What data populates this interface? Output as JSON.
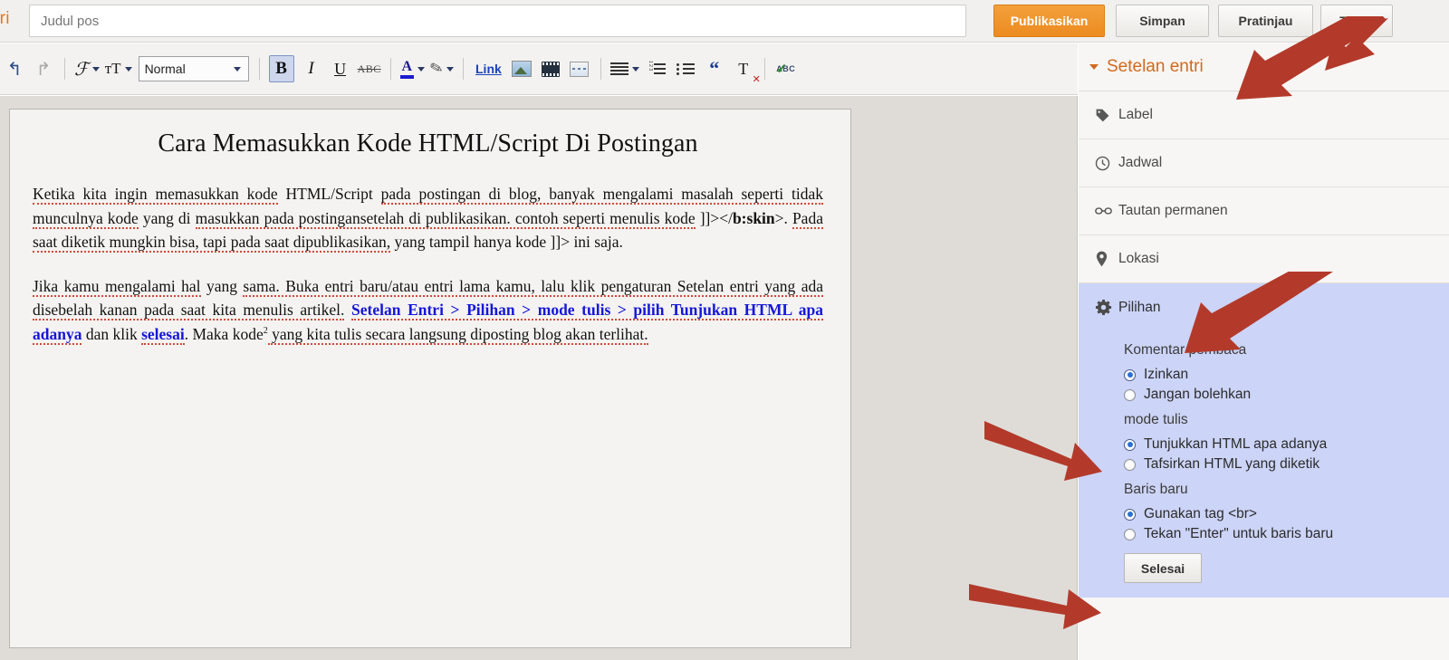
{
  "topbar": {
    "brand_cut": "tri",
    "title_placeholder": "Judul pos",
    "title_value": "",
    "publish_label": "Publikasikan",
    "save_label": "Simpan",
    "preview_label": "Pratinjau",
    "close_label": "Tutup",
    "publish_color": "#ec8b20"
  },
  "toolbar": {
    "undo": "↰",
    "redo": "↱",
    "font": "ℱ",
    "font_size": "тT",
    "format_select": "Normal",
    "bold": "B",
    "italic": "I",
    "underline": "U",
    "strikethrough": "ABC",
    "text_color": "A",
    "highlight": "✎",
    "link": "Link",
    "quote": "“",
    "remove_format": "T",
    "spellcheck": "ABC"
  },
  "document": {
    "title": "Cara Memasukkan Kode HTML/Script Di Postingan",
    "paragraph1": [
      {
        "t": "Ketika kita ingin memasukkan kode",
        "s": "spell"
      },
      {
        "t": " HTML/Script ",
        "s": "plain"
      },
      {
        "t": "pada postingan di blog,  banyak mengalami masalah seperti tidak munculnya kode",
        "s": "spell"
      },
      {
        "t": " yang di ",
        "s": "plain"
      },
      {
        "t": "masukkan pada postingansetelah di publikasikan. contoh seperti menulis kode",
        "s": "spell"
      },
      {
        "t": " ]]></",
        "s": "plain"
      },
      {
        "t": "b:skin",
        "s": "bold"
      },
      {
        "t": ">. ",
        "s": "plain"
      },
      {
        "t": "Pada saat diketik mungkin bisa, tapi pada saat dipublikasikan,",
        "s": "spell"
      },
      {
        "t": " yang tampil hanya kode ]]> ini saja.",
        "s": "plain"
      }
    ],
    "paragraph2": [
      {
        "t": "Jika kamu mengalami hal",
        "s": "spell"
      },
      {
        "t": " yang ",
        "s": "plain"
      },
      {
        "t": "sama. Buka entri baru/atau entri lama kamu, lalu klik pengaturan Setelan entri yang ada disebelah kanan pada saat kita menulis artikel.",
        "s": "spell"
      },
      {
        "t": " ",
        "s": "plain"
      },
      {
        "t": "Setelan Entri > Pilihan > mode tulis > pilih Tunjukan HTML apa adanya",
        "s": "blue"
      },
      {
        "t": " dan klik ",
        "s": "plain"
      },
      {
        "t": "selesai",
        "s": "blue"
      },
      {
        "t": ". Maka kode",
        "s": "plain"
      },
      {
        "t": "2",
        "s": "sup"
      },
      {
        "t": " yang kita tulis secara langsung diposting blog akan terlihat.",
        "s": "spell"
      }
    ]
  },
  "sidebar": {
    "header": "Setelan entri",
    "header_color": "#d2691e",
    "rows": [
      {
        "label": "Label",
        "icon": "tag-icon",
        "glyph": "🏷"
      },
      {
        "label": "Jadwal",
        "icon": "clock-icon",
        "glyph": "🕒"
      },
      {
        "label": "Tautan permanen",
        "icon": "link-icon",
        "glyph": "🔗"
      },
      {
        "label": "Lokasi",
        "icon": "location-pin-icon",
        "glyph": "📍"
      },
      {
        "label": "Pilihan",
        "icon": "gear-icon",
        "glyph": "⚙",
        "selected": true
      }
    ],
    "options": {
      "group_comments_label": "Komentar pembaca",
      "comments": [
        {
          "label": "Izinkan",
          "checked": true
        },
        {
          "label": "Jangan bolehkan",
          "checked": false
        }
      ],
      "group_mode_label": "mode tulis",
      "mode": [
        {
          "label": "Tunjukkan HTML apa adanya",
          "checked": true
        },
        {
          "label": "Tafsirkan HTML yang diketik",
          "checked": false
        }
      ],
      "group_newline_label": "Baris baru",
      "newline": [
        {
          "label": "Gunakan tag <br>",
          "checked": true
        },
        {
          "label": "Tekan \"Enter\" untuk baris baru",
          "checked": false
        }
      ],
      "done_label": "Selesai",
      "selected_bg": "#ccd4f7"
    }
  },
  "annotations": {
    "arrow_color": "#b33a2b",
    "arrows": [
      {
        "name": "arrow-to-setelan-entri",
        "points_to": "Setelan entri"
      },
      {
        "name": "arrow-to-pilihan",
        "points_to": "Pilihan"
      },
      {
        "name": "arrow-to-tunjukkan-html",
        "points_to": "Tunjukkan HTML apa adanya"
      },
      {
        "name": "arrow-to-selesai",
        "points_to": "Selesai"
      }
    ]
  }
}
